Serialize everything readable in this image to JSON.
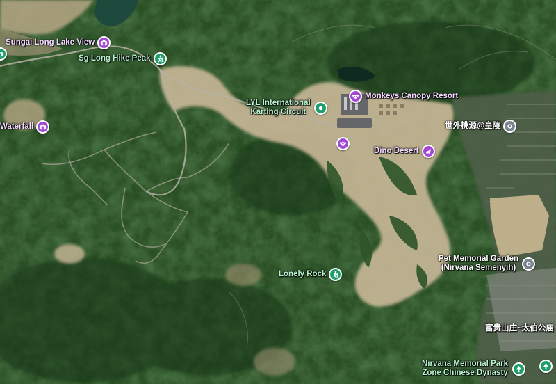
{
  "map": {
    "type": "satellite",
    "colors": {
      "attraction_pin": "#a349d6",
      "park_pin": "#1e9e6a",
      "place_pin": "#7a8591",
      "attraction_label": "#f3d9ff",
      "park_label": "#b8f2cf",
      "place_label": "#ffffff"
    }
  },
  "pois": [
    {
      "id": "sungai-long-lake-view",
      "label": "Sungai Long Lake View",
      "category": "attraction",
      "icon": "camera-icon"
    },
    {
      "id": "sg-long-hike-peak",
      "label": "Sg Long Hike Peak",
      "category": "park",
      "icon": "hiker-icon"
    },
    {
      "id": "waterfall",
      "label": "Waterfall",
      "category": "attraction",
      "icon": "camera-icon"
    },
    {
      "id": "lyl-karting",
      "label_lines": [
        "LYL International",
        "Karting Circuit"
      ],
      "category": "park",
      "icon": "circle-dot-icon"
    },
    {
      "id": "monkeys-canopy-resort",
      "label": "Monkeys Canopy Resort",
      "category": "attraction",
      "icon": "monkey-icon"
    },
    {
      "id": "unnamed-attraction",
      "label": "",
      "category": "attraction",
      "icon": "monkey-icon"
    },
    {
      "id": "dino-desert",
      "label": "Dino Desert",
      "category": "attraction",
      "icon": "dino-icon"
    },
    {
      "id": "shiwai-taoyuan",
      "label": "世外桃源@皇陵",
      "category": "place",
      "icon": "place-pin-icon"
    },
    {
      "id": "pet-memorial-garden",
      "label_lines": [
        "Pet Memorial Garden",
        "(Nirvana Semenyih)"
      ],
      "category": "place",
      "icon": "place-pin-icon"
    },
    {
      "id": "lonely-rock",
      "label": "Lonely Rock",
      "category": "park",
      "icon": "hiker-icon"
    },
    {
      "id": "fugui-shanzhuang",
      "label": "富贵山庄~太伯公庙",
      "category": "place",
      "icon": "none"
    },
    {
      "id": "nirvana-memorial-park",
      "label_lines": [
        "Nirvana Memorial Park",
        "Zone Chinese Dynasty"
      ],
      "category": "park",
      "icon": "tree-icon"
    },
    {
      "id": "edge-tree",
      "label": "",
      "category": "park",
      "icon": "tree-icon"
    },
    {
      "id": "edge-camera",
      "label": "",
      "category": "attraction",
      "icon": "camera-icon"
    }
  ]
}
